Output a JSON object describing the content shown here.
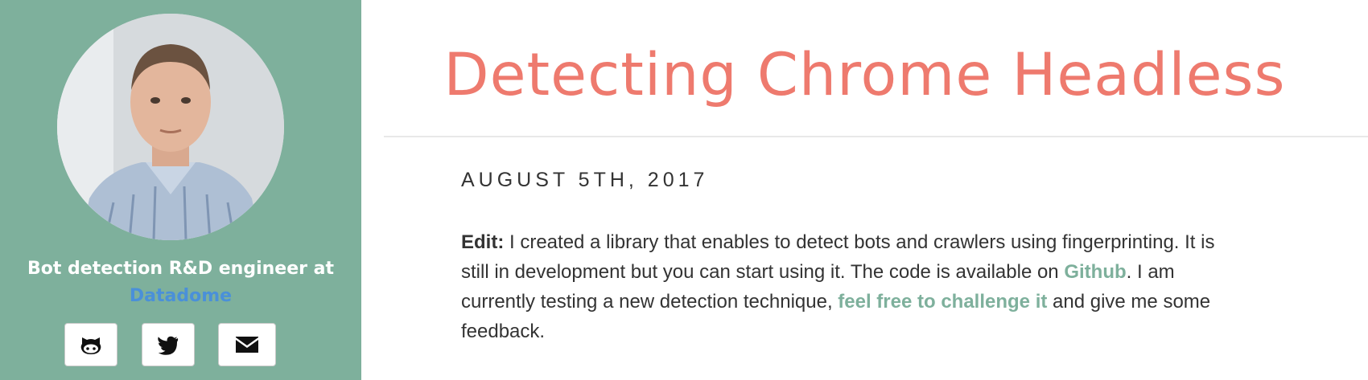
{
  "sidebar": {
    "bio_line1": "Bot detection R&D engineer at",
    "bio_link": "Datadome",
    "socials": [
      {
        "icon": "github-icon"
      },
      {
        "icon": "twitter-icon"
      },
      {
        "icon": "envelope-icon"
      }
    ]
  },
  "post": {
    "title": "Detecting Chrome Headless",
    "date": "AUGUST 5TH, 2017",
    "edit_label": "Edit:",
    "text1": " I created a library that enables to detect bots and crawlers using fingerprinting. It is still in development but you can start using it. The code is available on ",
    "link1": "Github",
    "text2": ". I am currently testing a new detection technique, ",
    "link2": "feel free to challenge it",
    "text3": " and give me some feedback."
  },
  "colors": {
    "sidebar_bg": "#7eb09c",
    "title": "#ee7a6e",
    "link_green": "#7eb09c",
    "link_blue": "#4a90d9"
  }
}
